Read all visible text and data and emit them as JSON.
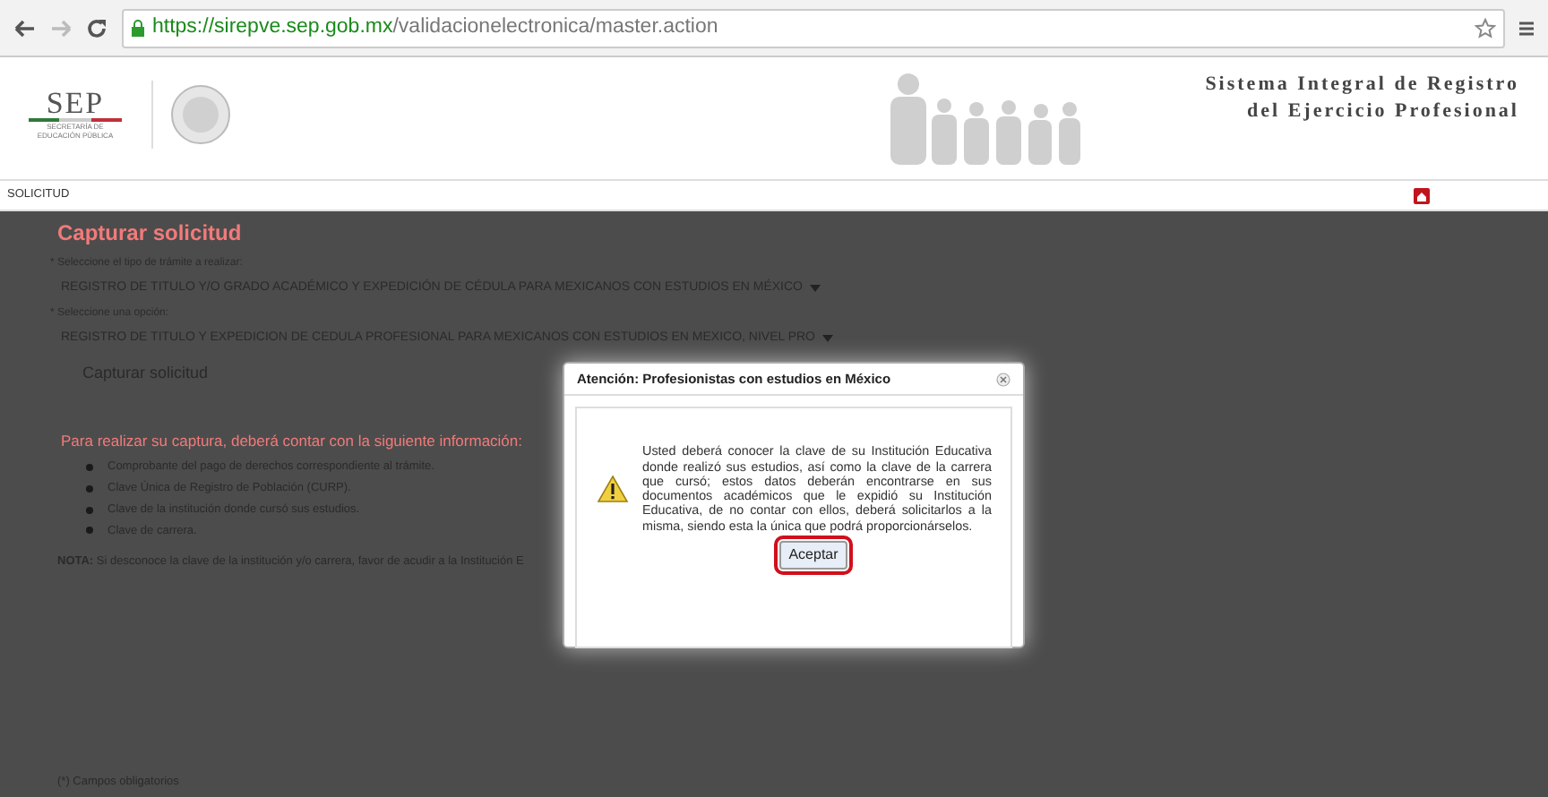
{
  "browser": {
    "url_host": "https://sirepve.sep.gob.mx",
    "url_path": "/validacionelectronica/master.action"
  },
  "header": {
    "logo": "SEP",
    "logo_subtitle": "SECRETARÍA DE EDUCACIÓN PÚBLICA",
    "title_lines": [
      "Sistema Integral de Registro",
      "del Ejercicio Profesional"
    ]
  },
  "breadcrumb": "SOLICITUD",
  "form": {
    "title": "Capturar solicitud",
    "fields": [
      {
        "label": "Seleccione el tipo de trámite a realizar:",
        "required_mark": "*",
        "value": "REGISTRO DE TITULO Y/O GRADO ACADÉMICO Y EXPEDICIÓN DE CÉDULA PARA MEXICANOS CON ESTUDIOS EN MÉXICO"
      },
      {
        "label": "Seleccione una opción:",
        "required_mark": "*",
        "value": "REGISTRO DE TITULO Y EXPEDICION DE CEDULA PROFESIONAL PARA MEXICANOS CON ESTUDIOS EN MEXICO, NIVEL PRO"
      }
    ],
    "submit": "Capturar solicitud",
    "info_title": "Para realizar su captura, deberá contar con la siguiente información:",
    "info_items": [
      "Comprobante del pago de derechos correspondiente al trámite.",
      "Clave Única de Registro de Población (CURP).",
      "Clave de la institución donde cursó sus estudios.",
      "Clave de carrera."
    ],
    "note": "**NOTA:** Si desconoce la clave de la institución y/o carrera, favor de acudir a la Institución E",
    "footnote": "(*) Campos obligatorios"
  },
  "dialog": {
    "title": "Atención: Profesionistas con estudios en México",
    "message": "Usted deberá conocer la clave de su Institución Educativa donde realizó sus estudios, así como la clave de la carrera que cursó; estos datos deberán encontrarse en sus documentos académicos que le expidió su Institución Educativa, de no contar con ellos, deberá solicitarlos a la misma, siendo esta la única que podrá proporcionárselos.",
    "button": "Aceptar",
    "button_highlighted": true
  }
}
